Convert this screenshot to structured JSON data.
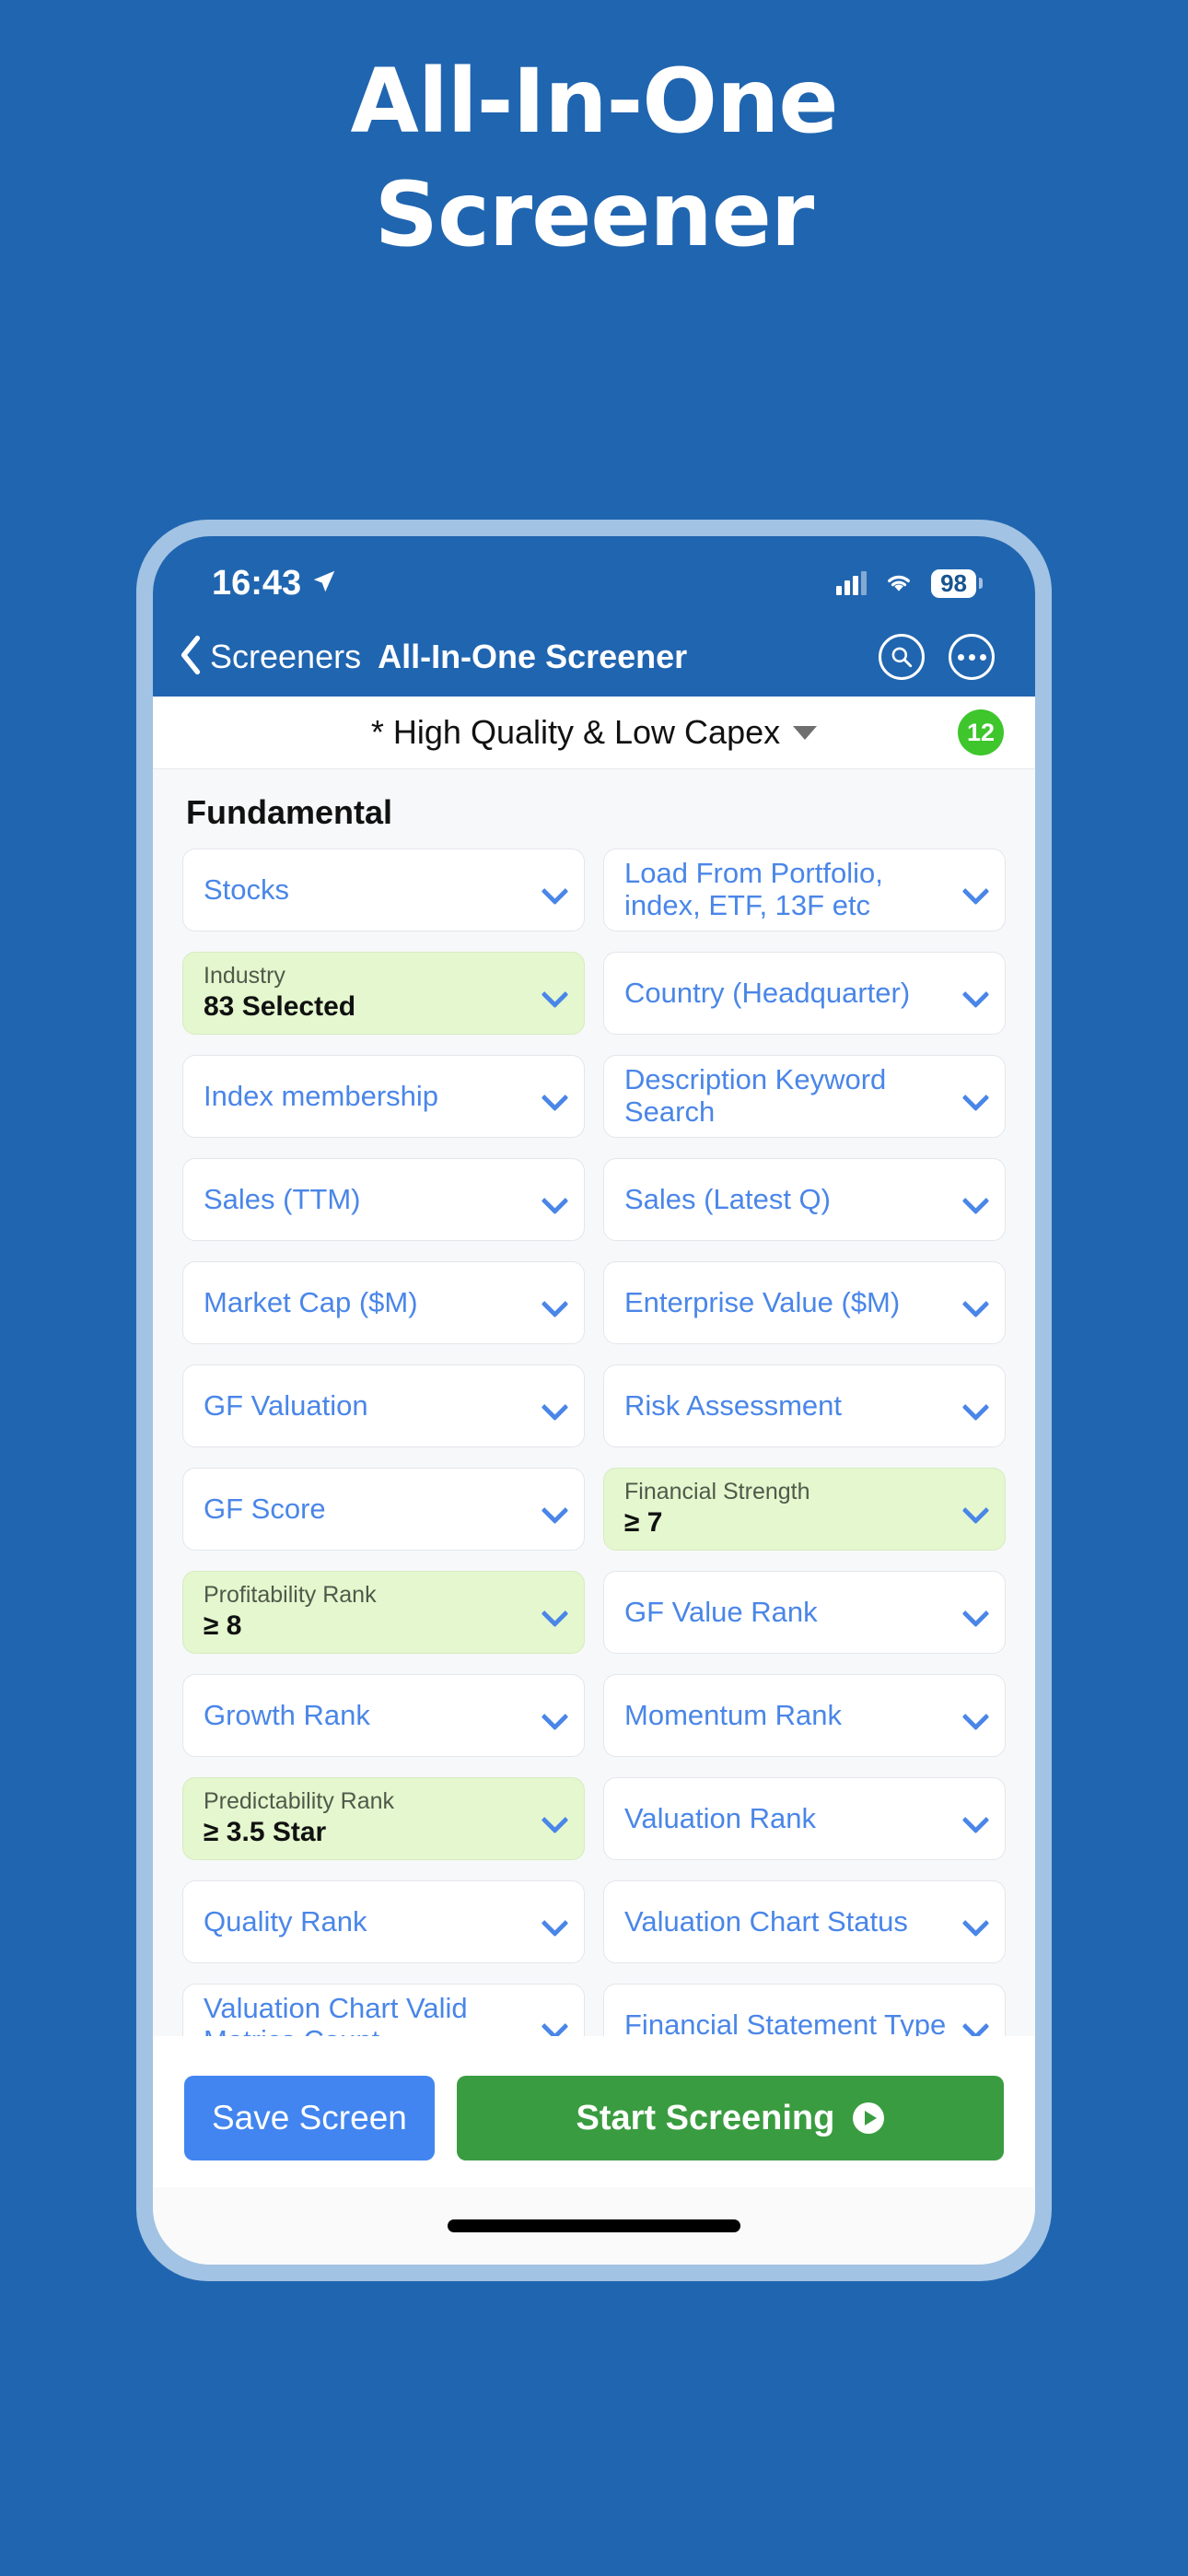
{
  "hero": {
    "line1": "All-In-One",
    "line2": "Screener"
  },
  "status_bar": {
    "time": "16:43",
    "battery": "98",
    "location_icon": "location-arrow-icon",
    "signal_icon": "cellular-signal-icon",
    "wifi_icon": "wifi-icon"
  },
  "nav": {
    "back_label": "Screeners",
    "back_icon": "chevron-left-icon",
    "title": "All-In-One Screener",
    "search_icon": "search-icon",
    "more_icon": "ellipsis-icon"
  },
  "preset": {
    "name": "* High Quality & Low Capex",
    "dropdown_icon": "triangle-down-icon",
    "badge": "12",
    "badge_color": "#3ec62c"
  },
  "section": {
    "title": "Fundamental"
  },
  "filters": [
    {
      "label": "Stocks",
      "value": "",
      "highlight": false
    },
    {
      "label": "Load From Portfolio, index, ETF, 13F etc",
      "value": "",
      "highlight": false
    },
    {
      "label": "Industry",
      "value": "83 Selected",
      "highlight": true
    },
    {
      "label": "Country (Headquarter)",
      "value": "",
      "highlight": false
    },
    {
      "label": "Index membership",
      "value": "",
      "highlight": false
    },
    {
      "label": "Description Keyword Search",
      "value": "",
      "highlight": false
    },
    {
      "label": "Sales (TTM)",
      "value": "",
      "highlight": false
    },
    {
      "label": "Sales (Latest Q)",
      "value": "",
      "highlight": false
    },
    {
      "label": "Market Cap ($M)",
      "value": "",
      "highlight": false
    },
    {
      "label": "Enterprise Value ($M)",
      "value": "",
      "highlight": false
    },
    {
      "label": "GF Valuation",
      "value": "",
      "highlight": false
    },
    {
      "label": "Risk Assessment",
      "value": "",
      "highlight": false
    },
    {
      "label": "GF Score",
      "value": "",
      "highlight": false
    },
    {
      "label": "Financial Strength",
      "value": "≥ 7",
      "highlight": true
    },
    {
      "label": "Profitability Rank",
      "value": "≥ 8",
      "highlight": true
    },
    {
      "label": "GF Value Rank",
      "value": "",
      "highlight": false
    },
    {
      "label": "Growth Rank",
      "value": "",
      "highlight": false
    },
    {
      "label": "Momentum Rank",
      "value": "",
      "highlight": false
    },
    {
      "label": "Predictability Rank",
      "value": "≥ 3.5 Star",
      "highlight": true
    },
    {
      "label": "Valuation Rank",
      "value": "",
      "highlight": false
    },
    {
      "label": "Quality Rank",
      "value": "",
      "highlight": false
    },
    {
      "label": "Valuation Chart Status",
      "value": "",
      "highlight": false
    },
    {
      "label": "Valuation Chart Valid Metrics Count",
      "value": "",
      "highlight": false
    },
    {
      "label": "Financial Statement Type",
      "value": "",
      "highlight": false
    }
  ],
  "actions": {
    "save_label": "Save Screen",
    "start_label": "Start Screening",
    "start_icon": "play-icon"
  },
  "colors": {
    "background_blue": "#2065b0",
    "bezel_blue": "#a2c3e3",
    "accent_blue": "#4a86e8",
    "highlight_green": "#e4f7ce",
    "primary_green": "#3a9c40",
    "save_blue": "#4285f0"
  }
}
